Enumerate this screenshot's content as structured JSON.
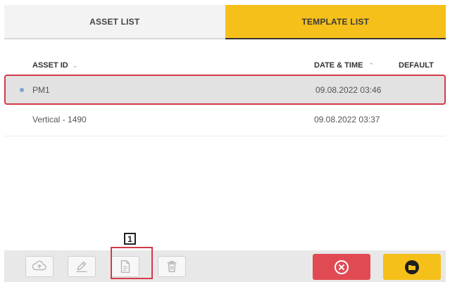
{
  "tabs": {
    "asset_list": "ASSET LIST",
    "template_list": "TEMPLATE LIST"
  },
  "columns": {
    "asset_id": "ASSET ID",
    "date_time": "DATE & TIME",
    "default": "DEFAULT"
  },
  "rows": [
    {
      "asset_id": "PM1",
      "date_time": "09.08.2022 03:46",
      "selected": true
    },
    {
      "asset_id": "Vertical - 1490",
      "date_time": "09.08.2022 03:37",
      "selected": false
    }
  ],
  "annotation": {
    "label": "1"
  },
  "toolbar": {
    "icons": [
      "cloud-upload-icon",
      "edit-icon",
      "document-icon",
      "trash-icon"
    ]
  },
  "actions": {
    "cancel_icon": "close-circle-icon",
    "open_icon": "folder-open-icon"
  },
  "colors": {
    "accent_yellow": "#f5c01a",
    "danger_red": "#e04a53",
    "selection_border": "#d23b4b"
  }
}
